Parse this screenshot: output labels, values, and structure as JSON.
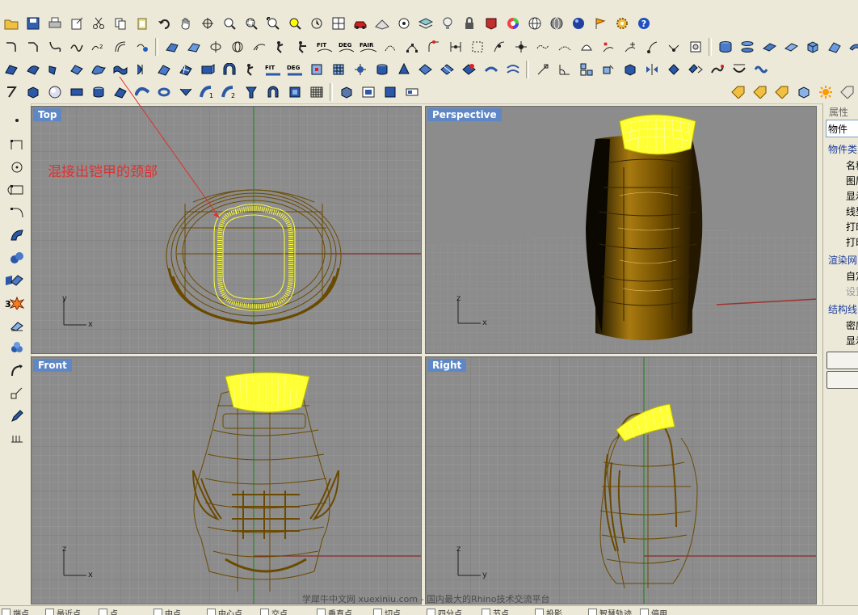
{
  "viewports": {
    "top": {
      "title": "Top"
    },
    "perspective": {
      "title": "Perspective"
    },
    "front": {
      "title": "Front"
    },
    "right": {
      "title": "Right"
    }
  },
  "annotation": "混接出铠甲的颈部",
  "watermark": "学犀牛中文网 xuexiniu.com  - 国内最大的Rhino技术交流平台",
  "toolbar_text_icons": {
    "fit": "FIT",
    "deg": "DEG",
    "fair": "FAIR"
  },
  "properties_panel": {
    "title": "属性",
    "dropdown_value": "物件",
    "section_object_type": "物件类",
    "rows": [
      "名称",
      "图层",
      "显示",
      "线型",
      "打印",
      "打印"
    ],
    "section_render_mesh": "渲染网",
    "render_rows": [
      "自定",
      "设置"
    ],
    "section_isocurves": "结构线",
    "iso_rows": [
      "密度",
      "显示"
    ]
  },
  "osnap_bar": [
    "端点",
    "最近点",
    "点",
    "中点",
    "中心点",
    "交点",
    "垂直点",
    "切点",
    "四分点",
    "节点",
    "投影",
    "智慧轨迹",
    "停用"
  ],
  "colors": {
    "viewport_bg": "#8c8c8c",
    "wire": "#6b4a00",
    "highlight": "#ffff33",
    "title_bg": "#5f87c5",
    "annotation": "#e03030"
  }
}
